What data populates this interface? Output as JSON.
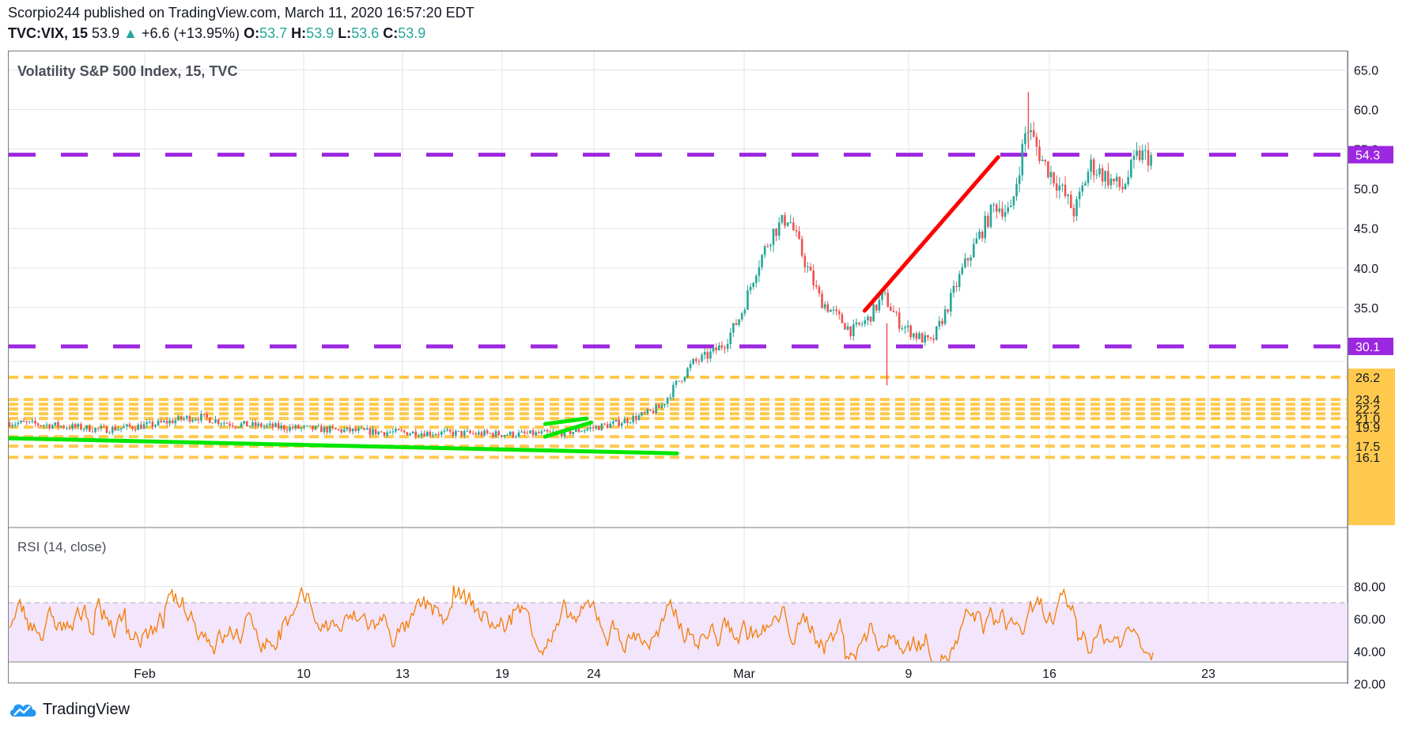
{
  "header": {
    "publisher_line": "Scorpio244 published on TradingView.com, March 11, 2020 16:57:20 EDT",
    "symbol": "TVC:VIX, 15",
    "last": "53.9",
    "change": "+6.6 (+13.95%)",
    "open_label": "O:",
    "open": "53.7",
    "high_label": "H:",
    "high": "53.9",
    "low_label": "L:",
    "low": "53.6",
    "close_label": "C:",
    "close": "53.9"
  },
  "footer": {
    "brand": "TradingView",
    "icon": "tradingview-cloud-icon"
  },
  "colors": {
    "up": "#26a69a",
    "down": "#ef5350",
    "resistance": "#9c27e0",
    "support_zone": "#ffc94d",
    "trend_green": "#00e600",
    "trend_red": "#ff0000",
    "rsi_line": "#f57c00",
    "rsi_band": "#f3e5fb",
    "grid": "#e0e3eb"
  },
  "chart_data": [
    {
      "type": "candlestick",
      "title": "Volatility S&P 500 Index, 15, TVC",
      "x_axis_ticks": [
        "Feb",
        "10",
        "13",
        "19",
        "24",
        "Mar",
        "9",
        "16",
        "23"
      ],
      "y_axis_ticks": [
        65.0,
        60.0,
        55.0,
        50.0,
        45.0,
        40.0,
        35.0
      ],
      "y_tick_labels": [
        "65.0",
        "60.0",
        "55.0",
        "50.0",
        "45.0",
        "40.0",
        "35.0"
      ],
      "price_labels": [
        "54.3",
        "30.1",
        "26.2",
        "23.4",
        "22.2",
        "21.0",
        "19.9",
        "17.5",
        "16.1"
      ],
      "resistance_levels": [
        54.3,
        30.1
      ],
      "support_levels": [
        26.2,
        23.4,
        22.8,
        22.2,
        21.6,
        21.0,
        19.9,
        18.7,
        17.5,
        16.1
      ],
      "price_path": [
        [
          0,
          20.5
        ],
        [
          3,
          20.1
        ],
        [
          6,
          19.6
        ],
        [
          9,
          20.2
        ],
        [
          11,
          21.0
        ],
        [
          12,
          21.2
        ],
        [
          14,
          20.3
        ],
        [
          17,
          19.9
        ],
        [
          20,
          19.6
        ],
        [
          23,
          19.3
        ],
        [
          26,
          19.2
        ],
        [
          29,
          19.1
        ],
        [
          32,
          19.0
        ],
        [
          35,
          19.2
        ],
        [
          38,
          20.3
        ],
        [
          40,
          21.5
        ],
        [
          41,
          22.5
        ],
        [
          42,
          25.5
        ],
        [
          43,
          28.0
        ],
        [
          44,
          29.0
        ],
        [
          45,
          30.5
        ],
        [
          46,
          34.0
        ],
        [
          47,
          40.0
        ],
        [
          48,
          44.5
        ],
        [
          49,
          46.5
        ],
        [
          50,
          41.0
        ],
        [
          51,
          36.0
        ],
        [
          52,
          34.0
        ],
        [
          53,
          32.0
        ],
        [
          54,
          33.5
        ],
        [
          55,
          36.5
        ],
        [
          56,
          33.0
        ],
        [
          57,
          31.5
        ],
        [
          58,
          30.5
        ],
        [
          59,
          35.0
        ],
        [
          60,
          40.0
        ],
        [
          61,
          44.0
        ],
        [
          62,
          48.0
        ],
        [
          63,
          47.0
        ],
        [
          64,
          58.0
        ],
        [
          65,
          53.5
        ],
        [
          66,
          50.5
        ],
        [
          67,
          47.0
        ],
        [
          68,
          53.0
        ],
        [
          69,
          51.5
        ],
        [
          70,
          50.0
        ],
        [
          71,
          54.3
        ],
        [
          72,
          53.9
        ]
      ],
      "trendlines": [
        {
          "color": "green",
          "points": [
            [
              0,
              18.5
            ],
            [
              42.0,
              16.6
            ]
          ]
        },
        {
          "color": "green",
          "points": [
            [
              33.7,
              20.3
            ],
            [
              36.3,
              21.0
            ]
          ]
        },
        {
          "color": "green",
          "points": [
            [
              33.7,
              18.7
            ],
            [
              36.6,
              20.5
            ]
          ]
        },
        {
          "color": "red",
          "points": [
            [
              53.8,
              34.6
            ],
            [
              62.2,
              54.0
            ]
          ]
        }
      ]
    },
    {
      "type": "line",
      "title": "RSI (14, close)",
      "y_axis_ticks": [
        80.0,
        60.0,
        40.0,
        20.0
      ],
      "y_tick_labels": [
        "80.00",
        "60.00",
        "40.00",
        "20.00"
      ],
      "band": [
        30,
        70
      ],
      "range_hint": [
        25,
        85
      ]
    }
  ]
}
